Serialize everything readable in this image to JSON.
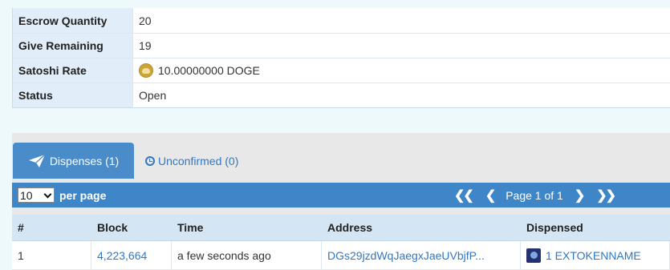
{
  "info": {
    "rows": [
      {
        "label": "Escrow Quantity",
        "value": "20"
      },
      {
        "label": "Give Remaining",
        "value": "19"
      },
      {
        "label": "Satoshi Rate",
        "value": "10.00000000 DOGE"
      },
      {
        "label": "Status",
        "value": "Open"
      }
    ],
    "satoshi_icon": "doge-coin-icon"
  },
  "tabs": {
    "active": {
      "label": "Dispenses (1)",
      "icon": "paper-plane-icon"
    },
    "inactive": {
      "label": "Unconfirmed (0)",
      "icon": "clock-icon"
    }
  },
  "toolbar": {
    "page_size": "10",
    "per_page_label": "per page",
    "first_label": "❮❮",
    "prev_label": "❮",
    "page_text": "Page 1 of 1",
    "next_label": "❯",
    "last_label": "❯❯"
  },
  "table": {
    "headers": [
      "#",
      "Block",
      "Time",
      "Address",
      "Dispensed"
    ],
    "rows": [
      {
        "index": "1",
        "block": "4,223,664",
        "time": "a few seconds ago",
        "address": "DGs29jzdWqJaegxJaeUVbjfP...",
        "dispensed": "1 EXTOKENNAME",
        "dispensed_icon": "token-icon"
      }
    ]
  },
  "colors": {
    "accent": "#3f86c8",
    "link": "#2f77c4",
    "label_bg": "#e1edf8"
  }
}
